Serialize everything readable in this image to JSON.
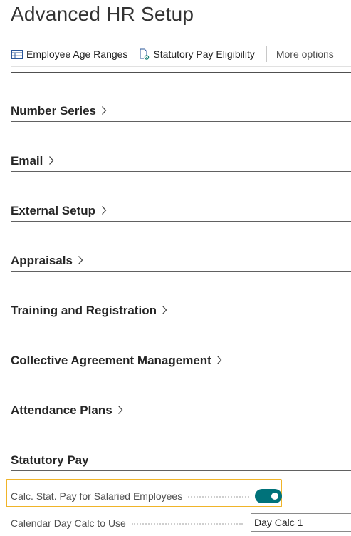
{
  "page": {
    "title": "Advanced HR Setup"
  },
  "actions": {
    "employee_age_ranges": "Employee Age Ranges",
    "statutory_pay_eligibility": "Statutory Pay Eligibility",
    "more_options": "More options"
  },
  "sections": {
    "number_series": "Number Series",
    "email": "Email",
    "external_setup": "External Setup",
    "appraisals": "Appraisals",
    "training": "Training and Registration",
    "collective": "Collective Agreement Management",
    "attendance": "Attendance Plans",
    "statutory_pay": "Statutory Pay"
  },
  "fields": {
    "calc_stat_pay_label": "Calc. Stat. Pay for Salaried Employees",
    "calc_stat_pay_value": true,
    "calendar_day_calc_label": "Calendar Day Calc to Use",
    "calendar_day_calc_value": "Day Calc 1"
  },
  "colors": {
    "accent": "#00727a",
    "highlight": "#f0b429"
  }
}
